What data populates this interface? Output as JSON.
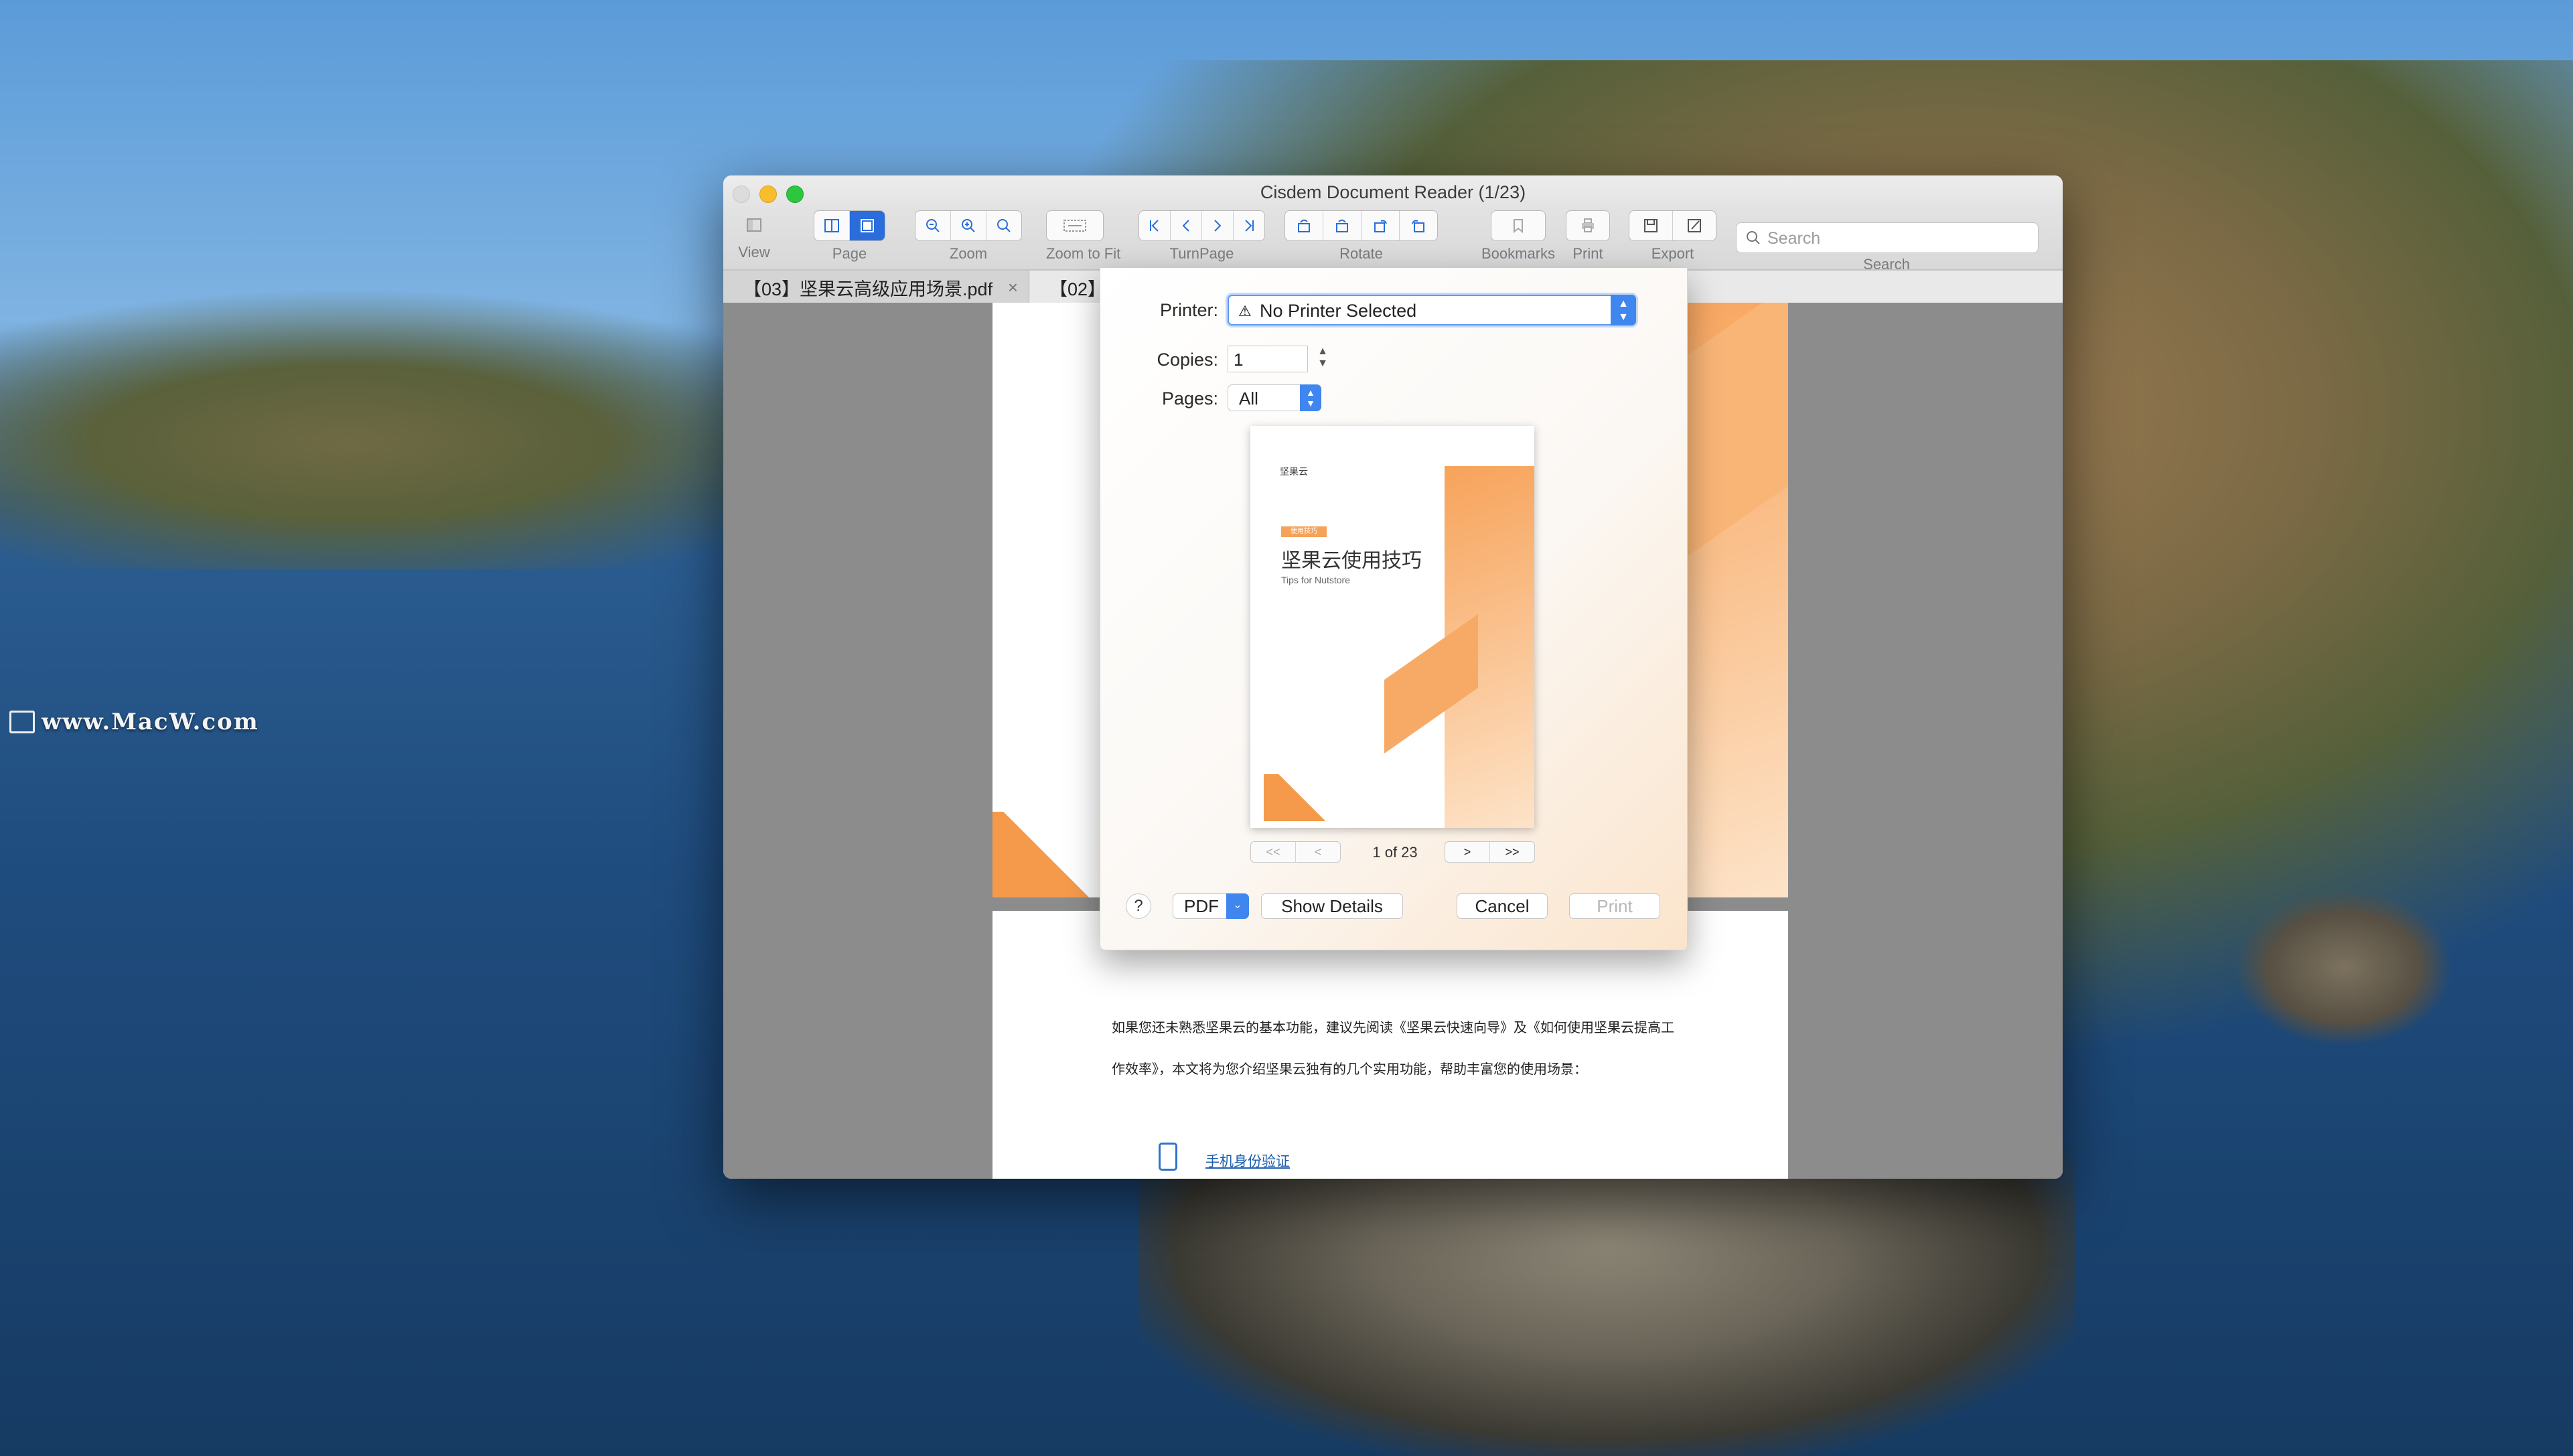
{
  "desktop": {
    "watermark": "www.MacW.com"
  },
  "window": {
    "title": "Cisdem Document Reader (1/23)"
  },
  "toolbar": {
    "view_label": "View",
    "page_label": "Page",
    "zoom_label": "Zoom",
    "zoom_to_fit_label": "Zoom to Fit",
    "turnpage_label": "TurnPage",
    "rotate_label": "Rotate",
    "bookmarks_label": "Bookmarks",
    "print_label": "Print",
    "export_label": "Export",
    "search_label": "Search",
    "search_placeholder": "Search"
  },
  "tabs": [
    {
      "label": "【03】坚果云高级应用场景.pdf",
      "close": "×"
    },
    {
      "label": "【02】"
    }
  ],
  "document": {
    "paragraph_line1": "如果您还未熟悉坚果云的基本功能，建议先阅读《坚果云快速向导》及《如何使用坚果云提高工",
    "paragraph_line2": "作效率》，本文将为您介绍坚果云独有的几个实用功能，帮助丰富您的使用场景：",
    "link_text": "手机身份验证"
  },
  "print_dialog": {
    "printer_label": "Printer:",
    "printer_value": "No Printer Selected",
    "printer_warning_icon": "⚠",
    "copies_label": "Copies:",
    "copies_value": "1",
    "pages_label": "Pages:",
    "pages_value": "All",
    "preview": {
      "logo_text": "坚果云",
      "badge_text": "使用技巧",
      "title": "坚果云使用技巧",
      "subtitle": "Tips for Nutstore"
    },
    "page_counter": "1 of 23",
    "nav_first": "<<",
    "nav_prev": "<",
    "nav_next": ">",
    "nav_last": ">>",
    "help": "?",
    "pdf_label": "PDF",
    "show_details": "Show Details",
    "cancel": "Cancel",
    "print": "Print"
  },
  "colors": {
    "accent": "#3f86ef",
    "orange": "#f8a55c"
  }
}
